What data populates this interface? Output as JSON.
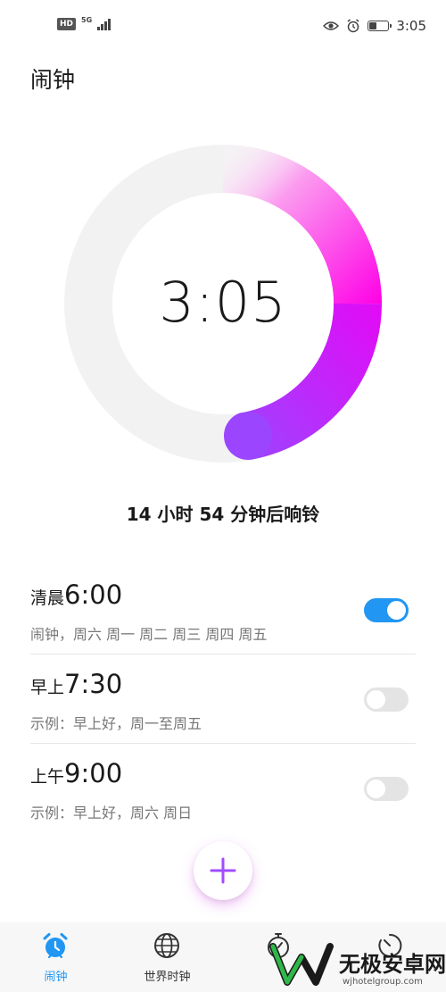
{
  "status_bar": {
    "hd_label": "HD",
    "network_label": "5G",
    "signal_level": 0.75,
    "battery_level": 0.4,
    "time": "3:05",
    "icons": [
      "eye-icon",
      "alarm-icon",
      "battery-icon"
    ]
  },
  "header": {
    "title": "闹钟"
  },
  "clock": {
    "time": "3:05",
    "ring_progress": 0.5,
    "accent_start": "#ff00e6",
    "accent_end": "#9b45ff"
  },
  "countdown": {
    "text": "14 小时 54 分钟后响铃"
  },
  "alarms": [
    {
      "period": "清晨",
      "time": "6:00",
      "subtitle": "闹钟，周六 周一 周二 周三 周四 周五",
      "enabled": true
    },
    {
      "period": "早上",
      "time": "7:30",
      "subtitle": "示例：早上好，周一至周五",
      "enabled": false
    },
    {
      "period": "上午",
      "time": "9:00",
      "subtitle": "示例：早上好，周六 周日",
      "enabled": false
    }
  ],
  "fab": {
    "icon": "plus-icon",
    "color": "#a24bff"
  },
  "bottom_nav": {
    "items": [
      {
        "label": "闹钟",
        "icon": "alarm-clock-icon",
        "active": true
      },
      {
        "label": "世界时钟",
        "icon": "globe-icon",
        "active": false
      },
      {
        "label": "",
        "icon": "stopwatch-icon",
        "active": false
      },
      {
        "label": "",
        "icon": "timer-icon",
        "active": false
      }
    ],
    "active_color": "#2196f3"
  },
  "watermark": {
    "text": "无极安卓网",
    "url": "wjhotelgroup.com"
  }
}
